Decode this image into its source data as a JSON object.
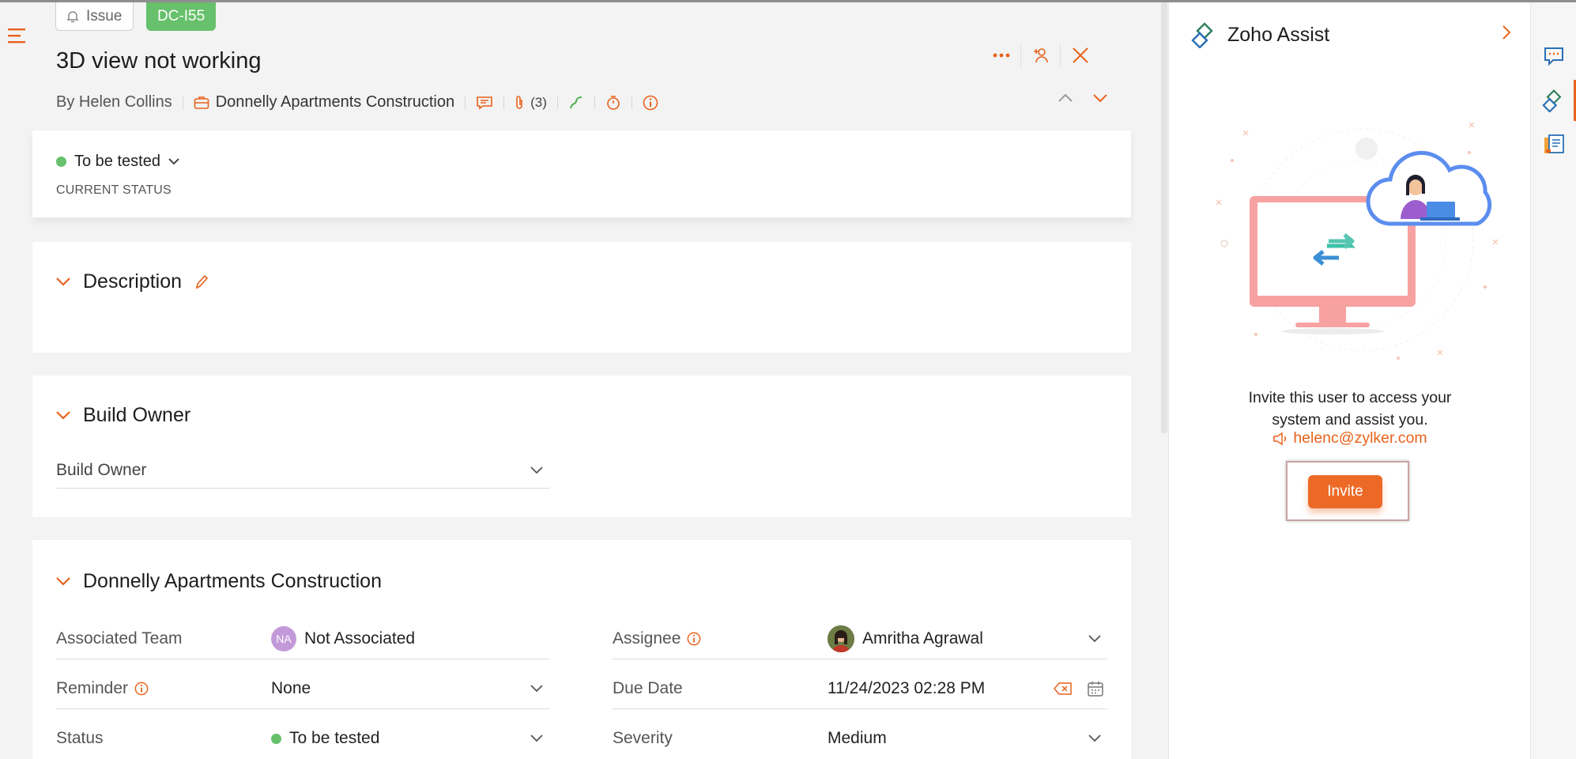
{
  "header": {
    "type_tag": "Issue",
    "id_tag": "DC-I55",
    "title": "3D view not working",
    "author": "By Helen Collins",
    "project": "Donnelly Apartments Construction",
    "attachments_count": "(3)"
  },
  "status": {
    "value": "To be tested",
    "label": "CURRENT STATUS",
    "color": "#67c06b"
  },
  "sections": {
    "description": "Description",
    "build_owner": "Build Owner",
    "build_owner_field": "Build Owner",
    "project": "Donnelly Apartments Construction"
  },
  "fields": {
    "associated_team_label": "Associated Team",
    "associated_team_badge": "NA",
    "associated_team_value": "Not Associated",
    "reminder_label": "Reminder",
    "reminder_value": "None",
    "status_label": "Status",
    "status_value": "To be tested",
    "assignee_label": "Assignee",
    "assignee_value": "Amritha Agrawal",
    "due_date_label": "Due Date",
    "due_date_value": "11/24/2023 02:28 PM",
    "severity_label": "Severity",
    "severity_value": "Medium"
  },
  "assist": {
    "title": "Zoho Assist",
    "invite_text_line1": "Invite this user to access your",
    "invite_text_line2": "system and assist you.",
    "email": "helenc@zylker.com",
    "invite_button": "Invite"
  },
  "colors": {
    "accent": "#e8621b",
    "status_green": "#67c06b",
    "invite_button": "#ec6a26"
  },
  "icons": [
    "menu-icon",
    "bell-icon",
    "more-icon",
    "follow-user-icon",
    "close-icon",
    "briefcase-icon",
    "comment-icon",
    "attachment-icon",
    "link-icon",
    "timer-icon",
    "info-icon",
    "chevron-up-icon",
    "chevron-down-icon",
    "pencil-icon",
    "calendar-icon",
    "clear-icon",
    "zoho-assist-logo",
    "chevron-right-icon",
    "chat-icon",
    "notes-icon",
    "speaker-icon"
  ]
}
